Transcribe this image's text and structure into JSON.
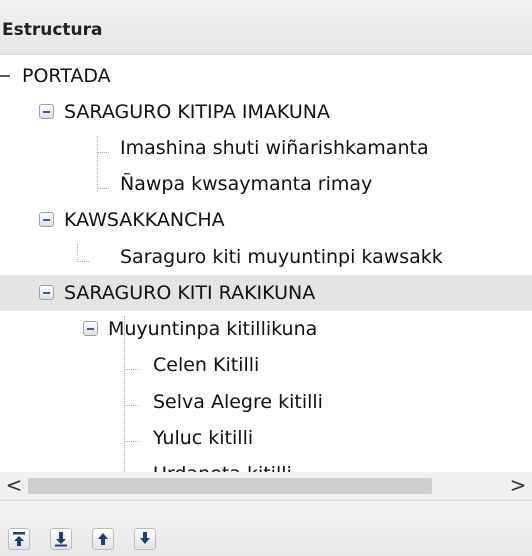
{
  "panel": {
    "title": "Estructura"
  },
  "tree": {
    "items": [
      {
        "label": "PORTADA",
        "expanded": true
      },
      {
        "label": "SARAGURO KITIPA IMAKUNA",
        "expanded": true
      },
      {
        "label": "Imashina shuti wiñarishkamanta"
      },
      {
        "label": "Ñawpa kwsaymanta rimay"
      },
      {
        "label": "KAWSAKKANCHA",
        "expanded": true
      },
      {
        "label": "Saraguro kiti muyuntinpi kawsakk"
      },
      {
        "label": "SARAGURO KITI RAKIKUNA",
        "expanded": true,
        "selected": true
      },
      {
        "label": "Muyuntinpa kitillikuna",
        "expanded": true
      },
      {
        "label": "Celen Kitilli"
      },
      {
        "label": "Selva Alegre kitilli"
      },
      {
        "label": "Yuluc kitilli"
      },
      {
        "label": "Urdaneta kitilli"
      }
    ]
  },
  "scrollbar": {
    "left_arrow": "<",
    "right_arrow": ">"
  },
  "toolbar": {
    "buttons": [
      {
        "icon": "move-to-top-icon"
      },
      {
        "icon": "move-down-icon"
      },
      {
        "icon": "move-up-icon"
      },
      {
        "icon": "move-to-bottom-icon"
      }
    ]
  }
}
